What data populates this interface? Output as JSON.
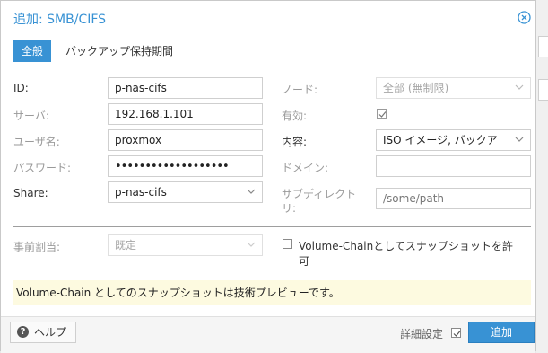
{
  "dialog": {
    "title": "追加: SMB/CIFS",
    "close_icon": "circle-x-icon"
  },
  "tabs": [
    {
      "label": "全般",
      "active": true
    },
    {
      "label": "バックアップ保持期間",
      "active": false
    }
  ],
  "left": {
    "id": {
      "label": "ID:",
      "value": "p-nas-cifs"
    },
    "server": {
      "label": "サーバ:",
      "value": "192.168.1.101"
    },
    "username": {
      "label": "ユーザ名:",
      "value": "proxmox"
    },
    "password": {
      "label": "パスワード:",
      "value": "•••••••••••••••••••"
    },
    "share": {
      "label": "Share:",
      "value": "p-nas-cifs"
    }
  },
  "right": {
    "node": {
      "label": "ノード:",
      "value": "全部 (無制限)"
    },
    "enabled": {
      "label": "有効:",
      "checked": true
    },
    "content": {
      "label": "内容:",
      "value": "ISO イメージ, バックア"
    },
    "domain": {
      "label": "ドメイン:",
      "value": ""
    },
    "subdir": {
      "label": "サブディレクトリ:",
      "label_line1": "サブディレクト",
      "label_line2": "リ:",
      "value": "",
      "placeholder": "/some/path"
    }
  },
  "prealloc": {
    "label": "事前割当:",
    "value": "既定"
  },
  "volume_chain": {
    "label_line1": "Volume-Chainとしてスナップショットを許",
    "label_line2": "可",
    "checked": false
  },
  "notice": {
    "text": "Volume-Chain としてのスナップショットは技術プレビューです。"
  },
  "footer": {
    "help_label": "ヘルプ",
    "advanced_label": "詳細設定",
    "advanced_checked": true,
    "add_label": "追加"
  },
  "colors": {
    "accent": "#3892d4",
    "notice_bg": "#fdfae0"
  }
}
